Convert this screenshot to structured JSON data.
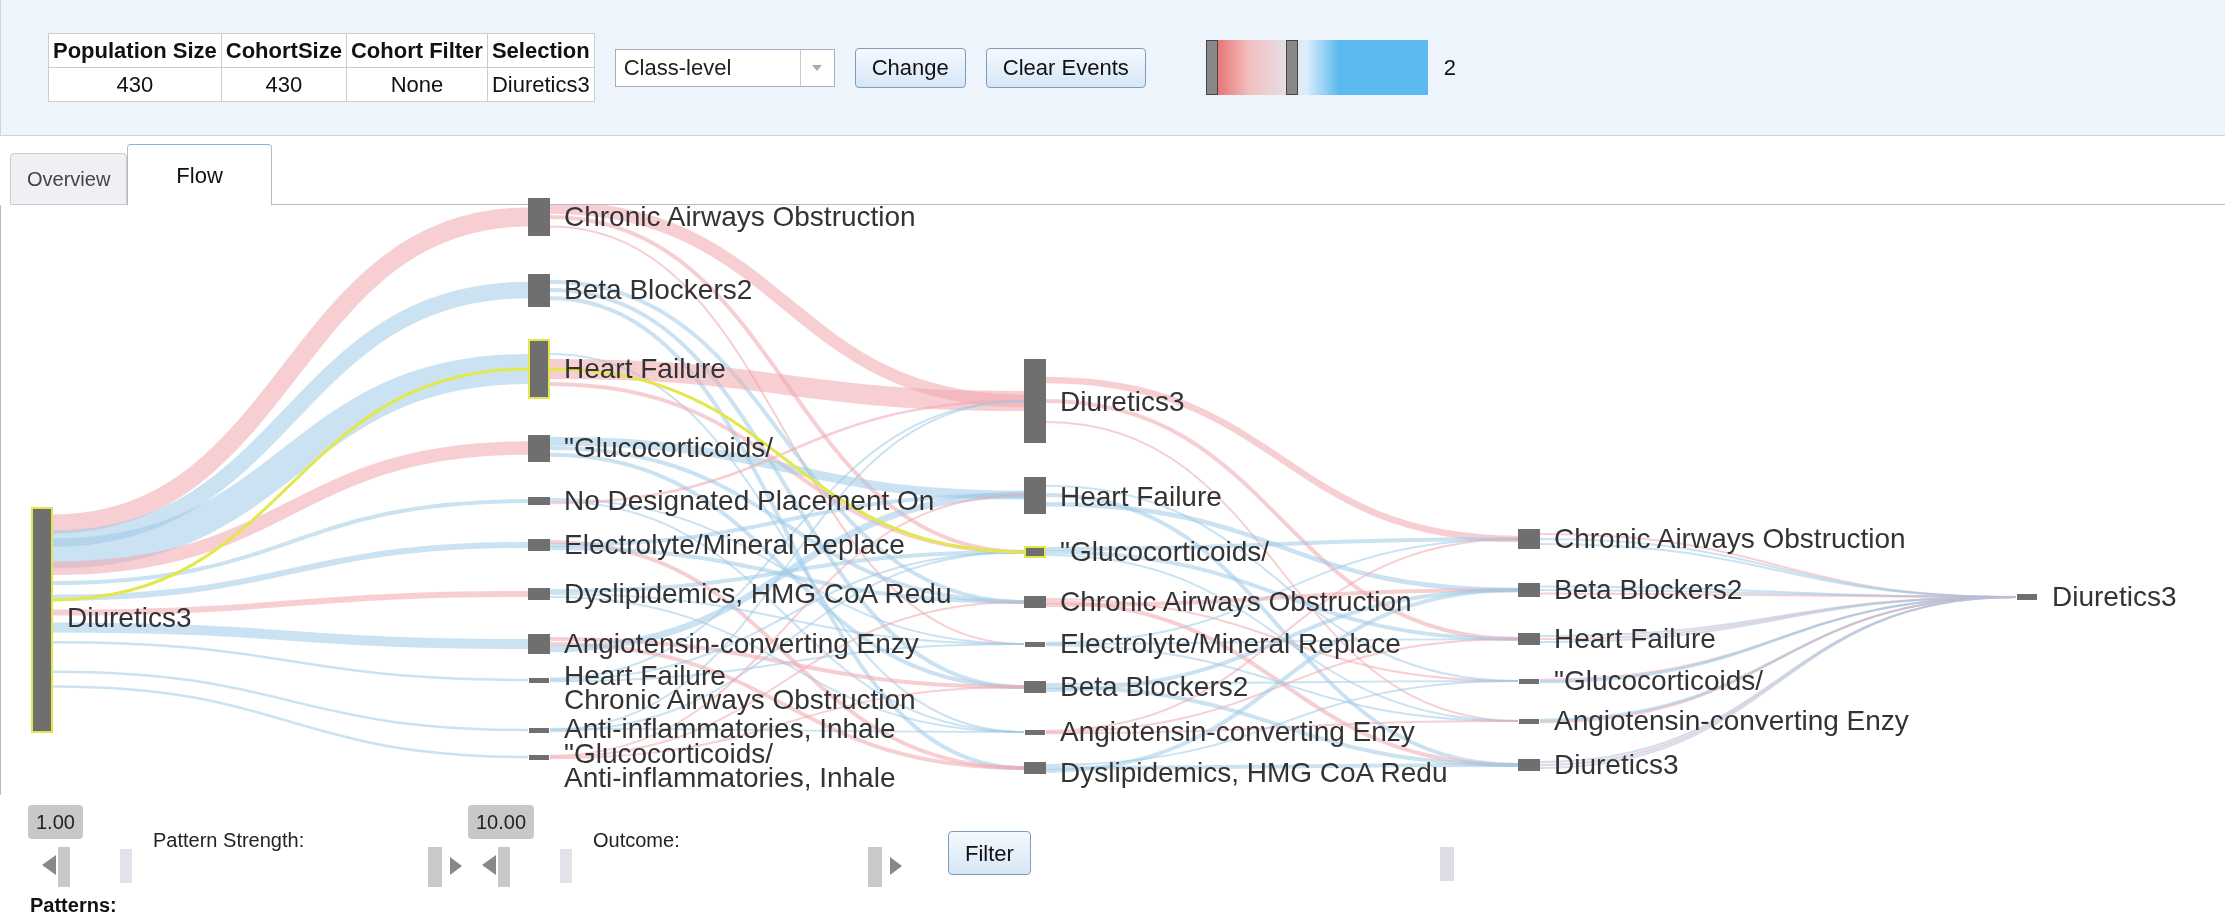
{
  "summary_table": {
    "columns": [
      "Population Size",
      "CohortSize",
      "Cohort Filter",
      "Selection"
    ],
    "row": [
      "430",
      "430",
      "None",
      "Diuretics3"
    ]
  },
  "level_dropdown": {
    "value": "Class-level"
  },
  "buttons": [
    "Change",
    "Clear Events"
  ],
  "color_range": {
    "reading": "2",
    "handles": [
      {
        "level": 0
      },
      {
        "level": 0.38
      }
    ]
  },
  "tabs": [
    {
      "label": "Overview",
      "selected": false
    },
    {
      "label": "Flow",
      "selected": true
    }
  ],
  "flow": {
    "columns": [
      {
        "nodes": [
          {
            "label": "Diuretics3",
            "highlighted": true
          }
        ]
      },
      {
        "nodes": [
          {
            "label": "Chronic Airways Obstruction",
            "highlighted": false
          },
          {
            "label": "Beta Blockers2",
            "highlighted": false
          },
          {
            "label": "Heart Failure",
            "highlighted": true
          },
          {
            "label": "\"Glucocorticoids/",
            "highlighted": false
          },
          {
            "label": "No Designated Placement On",
            "highlighted": false
          },
          {
            "label": "Electrolyte/Mineral Replace",
            "highlighted": false
          },
          {
            "label": "Dyslipidemics, HMG CoA Redu",
            "highlighted": false
          },
          {
            "label": "Angiotensin-converting Enzy",
            "highlighted": false
          },
          {
            "label": "Heart Failure",
            "highlighted": false
          },
          {
            "label": "Chronic Airways Obstruction"
          },
          {
            "label": "Anti-inflammatories, Inhale",
            "highlighted": false
          },
          {
            "label": "\"Glucocorticoids/",
            "highlighted": false
          },
          {
            "label": "Anti-inflammatories, Inhale"
          }
        ]
      },
      {
        "nodes": [
          {
            "label": "Diuretics3",
            "highlighted": false
          },
          {
            "label": "Heart Failure",
            "highlighted": false
          },
          {
            "label": "\"Glucocorticoids/",
            "highlighted": true
          },
          {
            "label": "Chronic Airways Obstruction",
            "highlighted": false
          },
          {
            "label": "Electrolyte/Mineral Replace",
            "highlighted": false
          },
          {
            "label": "Beta Blockers2",
            "highlighted": false
          },
          {
            "label": "Angiotensin-converting Enzy",
            "highlighted": false
          },
          {
            "label": "Dyslipidemics, HMG CoA Redu",
            "highlighted": false
          }
        ]
      },
      {
        "nodes": [
          {
            "label": "Chronic Airways Obstruction",
            "highlighted": false
          },
          {
            "label": "Beta Blockers2",
            "highlighted": false
          },
          {
            "label": "Heart Failure",
            "highlighted": false
          },
          {
            "label": "\"Glucocorticoids/",
            "highlighted": false
          },
          {
            "label": "Angiotensin-converting Enzy",
            "highlighted": false
          },
          {
            "label": "Diuretics3",
            "highlighted": false
          }
        ]
      },
      {
        "nodes": [
          {
            "label": "Diuretics3",
            "highlighted": false
          }
        ]
      }
    ]
  },
  "sliders": [
    {
      "value": "1.00",
      "label": "Pattern Strength:",
      "level": 0
    },
    {
      "value": "10.00",
      "label": "Outcome:",
      "level": 0
    }
  ],
  "filter_button": "Filter",
  "patterns_heading": "Patterns:"
}
